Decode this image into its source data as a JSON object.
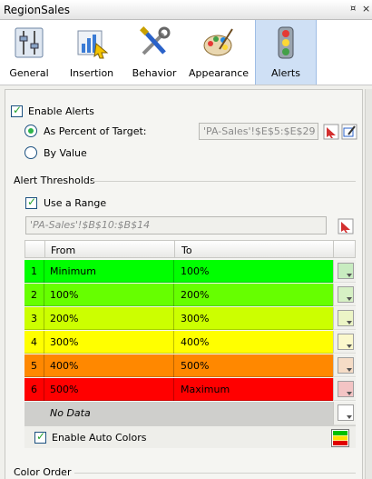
{
  "window": {
    "title": "RegionSales",
    "pin_glyph": "¤",
    "close_glyph": "×"
  },
  "tabs": [
    {
      "label": "General",
      "icon": "general-icon"
    },
    {
      "label": "Insertion",
      "icon": "insertion-icon"
    },
    {
      "label": "Behavior",
      "icon": "behavior-icon"
    },
    {
      "label": "Appearance",
      "icon": "appearance-icon"
    },
    {
      "label": "Alerts",
      "icon": "traffic-light-icon",
      "active": true
    }
  ],
  "alerts": {
    "enable_label": "Enable Alerts",
    "enable_checked": true,
    "percent_label": "As Percent of Target:",
    "percent_selected": true,
    "percent_range": "'PA-Sales'!$E$5:$E$29",
    "value_label": "By Value",
    "thresholds_label": "Alert Thresholds",
    "use_range_label": "Use a Range",
    "use_range_checked": true,
    "range_ref": "'PA-Sales'!$B$10:$B$14"
  },
  "grid": {
    "col_from": "From",
    "col_to": "To",
    "rows": [
      {
        "n": "1",
        "from": "Minimum",
        "to": "100%",
        "color": "#00ff00",
        "swatch": "#c8ecc0"
      },
      {
        "n": "2",
        "from": "100%",
        "to": "200%",
        "color": "#66ff00",
        "swatch": "#d6f0c4"
      },
      {
        "n": "3",
        "from": "200%",
        "to": "300%",
        "color": "#ccff00",
        "swatch": "#ecf5c6"
      },
      {
        "n": "4",
        "from": "300%",
        "to": "400%",
        "color": "#ffff00",
        "swatch": "#fbf8cc"
      },
      {
        "n": "5",
        "from": "400%",
        "to": "500%",
        "color": "#ff8800",
        "swatch": "#f5dcc6"
      },
      {
        "n": "6",
        "from": "500%",
        "to": "Maximum",
        "color": "#ff0000",
        "swatch": "#f3c4c4"
      }
    ],
    "no_data_label": "No Data",
    "auto_colors_label": "Enable Auto Colors",
    "auto_colors_checked": true
  },
  "color_order_label": "Color Order",
  "colors": {
    "accent_blue": "#cfe0f5",
    "check_green": "#23a22b"
  }
}
